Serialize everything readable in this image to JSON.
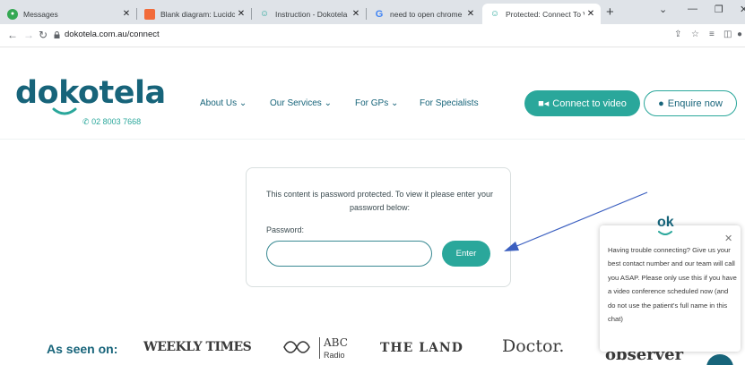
{
  "browser": {
    "tabs": [
      {
        "title": "Messages",
        "favicon": "messages-icon",
        "color": "#34a853",
        "active": false
      },
      {
        "title": "Blank diagram: Lucidchart",
        "favicon": "lucidchart-icon",
        "color": "#f26b3a",
        "active": false
      },
      {
        "title": "Instruction - Dokotela",
        "favicon": "dokotela-icon",
        "color": "#2aa79b",
        "active": false
      },
      {
        "title": "need to open chrome br",
        "favicon": "google-icon",
        "color": "#4285f4",
        "active": false
      },
      {
        "title": "Protected: Connect To Vi",
        "favicon": "dokotela-icon",
        "color": "#2aa79b",
        "active": true
      }
    ],
    "new_tab": "+",
    "url": "dokotela.com.au/connect"
  },
  "site": {
    "logo_text": "dokotela",
    "phone": "02 8003 7668",
    "nav": [
      "About Us",
      "Our Services",
      "For GPs",
      "For Specialists"
    ],
    "connect_label": "Connect to video",
    "enquire_label": "Enquire now"
  },
  "password": {
    "message": "This content is password protected. To view it please enter your password below:",
    "label": "Password:",
    "value": "",
    "enter_label": "Enter"
  },
  "seen_on": {
    "label": "As seen on:",
    "outlets": [
      "WEEKLY TIMES",
      "ABC",
      "Radio",
      "THE LAND",
      "Doctor.",
      "observer"
    ]
  },
  "chat": {
    "logo": "ok",
    "message": "Having trouble connecting? Give us your best contact number and our team will call you ASAP. Please only use this if you have a video conference scheduled now (and do not use the patient's full name in this chat)"
  },
  "colors": {
    "brand_dark": "#17647a",
    "brand_teal": "#2aa79b",
    "annotation_arrow": "#3b5fc0"
  }
}
